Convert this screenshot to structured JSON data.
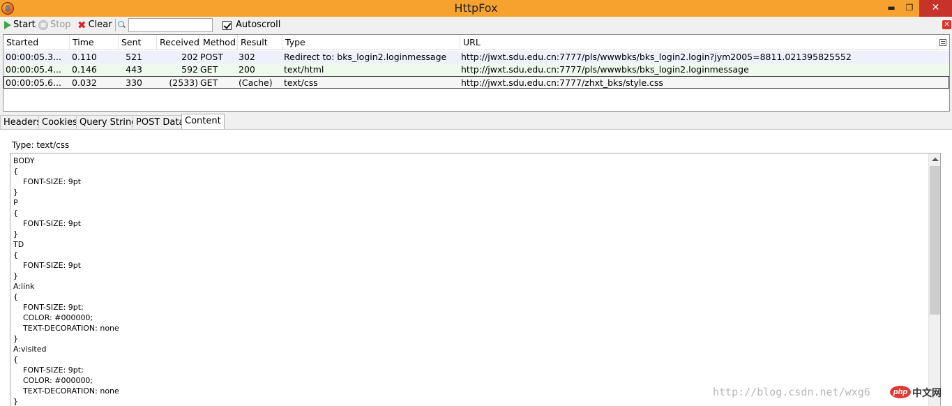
{
  "window": {
    "title": "HttpFox",
    "minimize": "▬",
    "maximize": "❐",
    "close": "✕"
  },
  "toolbar": {
    "start_label": "Start",
    "stop_label": "Stop",
    "clear_label": "Clear",
    "search_value": "",
    "autoscroll_label": "Autoscroll",
    "autoscroll_checked": true,
    "close_glyph": "✕"
  },
  "columns": [
    "Started",
    "Time",
    "Sent",
    "Received",
    "Method",
    "Result",
    "Type",
    "URL"
  ],
  "requests": [
    {
      "started": "00:00:05.3...",
      "time": "0.110",
      "sent": "521",
      "received": "202",
      "method": "POST",
      "result": "302",
      "type": "Redirect to: bks_login2.loginmessage",
      "url": "http://jwxt.sdu.edu.cn:7777/pls/wwwbks/bks_login2.login?jym2005=8811.021395825552"
    },
    {
      "started": "00:00:05.4...",
      "time": "0.146",
      "sent": "443",
      "received": "592",
      "method": "GET",
      "result": "200",
      "type": "text/html",
      "url": "http://jwxt.sdu.edu.cn:7777/pls/wwwbks/bks_login2.loginmessage"
    },
    {
      "started": "00:00:05.6...",
      "time": "0.032",
      "sent": "330",
      "received": "(2533)",
      "method": "GET",
      "result": "(Cache)",
      "type": "text/css",
      "url": "http://jwxt.sdu.edu.cn:7777/zhxt_bks/style.css"
    }
  ],
  "tabs": [
    {
      "label": "Headers",
      "active": false
    },
    {
      "label": "Cookies",
      "active": false
    },
    {
      "label": "Query String",
      "active": false
    },
    {
      "label": "POST Data",
      "active": false
    },
    {
      "label": "Content",
      "active": true
    }
  ],
  "content": {
    "type_label": "Type: text/css",
    "lines": [
      "BODY",
      "{",
      "    FONT-SIZE: 9pt",
      "}",
      "P",
      "{",
      "    FONT-SIZE: 9pt",
      "}",
      "TD",
      "{",
      "    FONT-SIZE: 9pt",
      "}",
      "A:link",
      "{",
      "    FONT-SIZE: 9pt;",
      "    COLOR: #000000;",
      "    TEXT-DECORATION: none",
      "}",
      "A:visited",
      "{",
      "    FONT-SIZE: 9pt;",
      "    COLOR: #000000;",
      "    TEXT-DECORATION: none",
      "}"
    ]
  },
  "watermark": {
    "url_text": "http://blog.csdn.net/wxg6",
    "logo_badge": "php",
    "logo_text": "中文网"
  },
  "colors": {
    "titlebar": "#f7a12e",
    "close_button": "#c7322a",
    "row_post": "#eef0fb",
    "row_get": "#eefaee"
  }
}
